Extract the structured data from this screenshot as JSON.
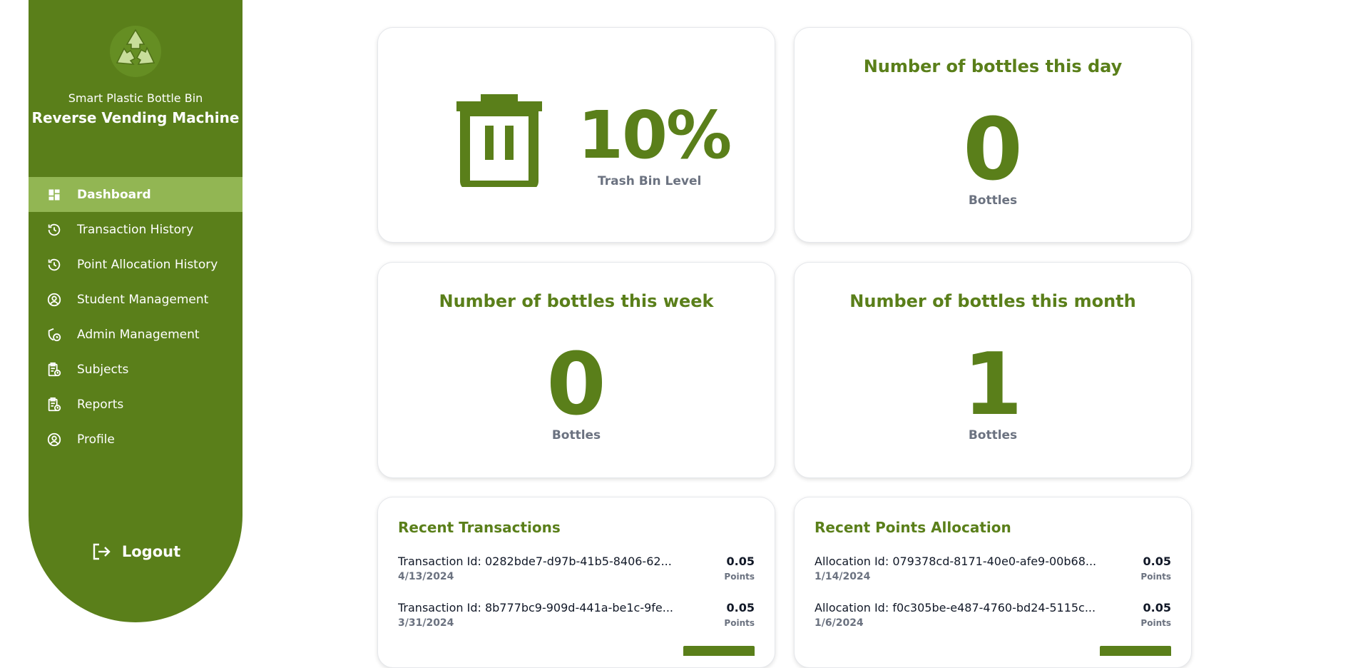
{
  "sidebar": {
    "brand_subtitle": "Smart Plastic Bottle Bin",
    "brand_title": "Reverse Vending Machine",
    "logo_icon": "recycle-icon",
    "items": [
      {
        "label": "Dashboard",
        "icon": "dashboard-icon",
        "active": true
      },
      {
        "label": "Transaction History",
        "icon": "history-icon"
      },
      {
        "label": "Point Allocation History",
        "icon": "history-icon"
      },
      {
        "label": "Student Management",
        "icon": "user-circle-icon"
      },
      {
        "label": "Admin Management",
        "icon": "admin-shield-icon"
      },
      {
        "label": "Subjects",
        "icon": "clipboard-clock-icon"
      },
      {
        "label": "Reports",
        "icon": "clipboard-clock-icon"
      },
      {
        "label": "Profile",
        "icon": "user-circle-icon"
      }
    ],
    "logout_label": "Logout"
  },
  "bin": {
    "percent": "10%",
    "label": "Trash Bin Level",
    "icon": "trash-bin-icon"
  },
  "day": {
    "title": "Number of bottles this day",
    "value": "0",
    "unit": "Bottles"
  },
  "week": {
    "title": "Number of bottles this week",
    "value": "0",
    "unit": "Bottles"
  },
  "month": {
    "title": "Number of bottles this month",
    "value": "1",
    "unit": "Bottles"
  },
  "transactions": {
    "title": "Recent Transactions",
    "rows": [
      {
        "id": "Transaction Id: 0282bde7-d97b-41b5-8406-62...",
        "date": "4/13/2024",
        "value": "0.05",
        "unit": "Points"
      },
      {
        "id": "Transaction Id: 8b777bc9-909d-441a-be1c-9fe...",
        "date": "3/31/2024",
        "value": "0.05",
        "unit": "Points"
      }
    ]
  },
  "allocations": {
    "title": "Recent Points Allocation",
    "rows": [
      {
        "id": "Allocation Id: 079378cd-8171-40e0-afe9-00b68...",
        "date": "1/14/2024",
        "value": "0.05",
        "unit": "Points"
      },
      {
        "id": "Allocation Id: f0c305be-e487-4760-bd24-5115c...",
        "date": "1/6/2024",
        "value": "0.05",
        "unit": "Points"
      }
    ]
  },
  "colors": {
    "primary": "#5a7f1a",
    "active_nav": "#92b653"
  }
}
